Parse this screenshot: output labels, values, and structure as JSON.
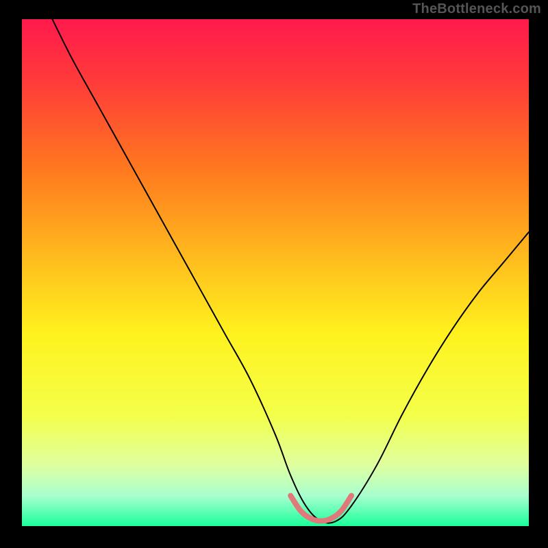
{
  "watermark": "TheBottleneck.com",
  "chart_data": {
    "type": "line",
    "title": "",
    "xlabel": "",
    "ylabel": "",
    "xlim": [
      0,
      100
    ],
    "ylim": [
      0,
      100
    ],
    "background_gradient_stops": [
      {
        "offset": 0.0,
        "color": "#ff1a4d"
      },
      {
        "offset": 0.12,
        "color": "#ff3a3a"
      },
      {
        "offset": 0.3,
        "color": "#ff7a1e"
      },
      {
        "offset": 0.48,
        "color": "#ffbf1e"
      },
      {
        "offset": 0.62,
        "color": "#fff21e"
      },
      {
        "offset": 0.78,
        "color": "#f4ff4a"
      },
      {
        "offset": 0.88,
        "color": "#dfffa0"
      },
      {
        "offset": 0.94,
        "color": "#a8ffcf"
      },
      {
        "offset": 1.0,
        "color": "#1aff9a"
      }
    ],
    "series": [
      {
        "name": "bottleneck-curve",
        "color": "#000000",
        "width": 2.0,
        "x": [
          6,
          10,
          15,
          20,
          25,
          30,
          35,
          40,
          45,
          50,
          53,
          56,
          59,
          62,
          65,
          70,
          75,
          80,
          85,
          90,
          95,
          100
        ],
        "y": [
          100,
          92,
          83,
          74,
          65,
          56,
          47,
          38,
          29,
          18,
          10,
          4,
          1,
          1,
          4,
          12,
          22,
          31,
          39,
          46,
          52,
          58
        ]
      },
      {
        "name": "optimal-band",
        "color": "#e07a7a",
        "width": 8.0,
        "x": [
          53,
          55,
          57,
          59,
          61,
          63,
          65
        ],
        "y": [
          6,
          3,
          1.5,
          1,
          1.5,
          3,
          6
        ]
      }
    ]
  }
}
